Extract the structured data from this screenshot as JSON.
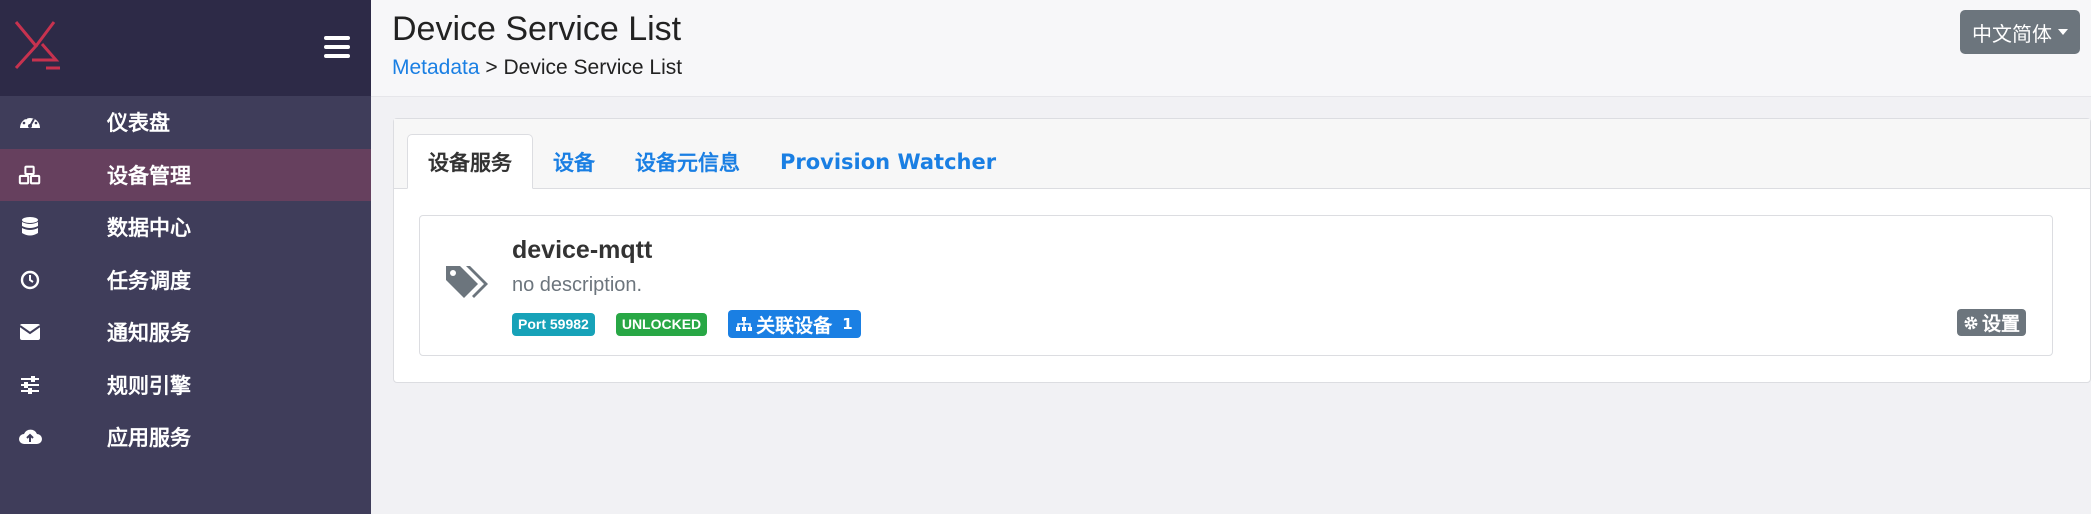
{
  "sidebar": {
    "items": [
      {
        "label": "仪表盘",
        "icon": "dashboard-icon",
        "active": false
      },
      {
        "label": "设备管理",
        "icon": "cubes-icon",
        "active": true
      },
      {
        "label": "数据中心",
        "icon": "database-icon",
        "active": false
      },
      {
        "label": "任务调度",
        "icon": "clock-icon",
        "active": false
      },
      {
        "label": "通知服务",
        "icon": "envelope-icon",
        "active": false
      },
      {
        "label": "规则引擎",
        "icon": "sliders-icon",
        "active": false
      },
      {
        "label": "应用服务",
        "icon": "cloud-upload-icon",
        "active": false
      }
    ]
  },
  "header": {
    "title": "Device Service List",
    "breadcrumb": {
      "parent": "Metadata",
      "separator": ">",
      "current": "Device Service List"
    },
    "language": "中文简体"
  },
  "tabs": [
    {
      "label": "设备服务",
      "active": true
    },
    {
      "label": "设备",
      "active": false
    },
    {
      "label": "设备元信息",
      "active": false
    },
    {
      "label": "Provision Watcher",
      "active": false
    }
  ],
  "service": {
    "name": "device-mqtt",
    "description": "no description.",
    "port_badge": "Port 59982",
    "lock_badge": "UNLOCKED",
    "assoc_label": "关联设备",
    "assoc_count": "1",
    "settings_label": "设置"
  },
  "colors": {
    "sidebar_bg": "#3f3d5a",
    "sidebar_header_bg": "#2d2a47",
    "active_item_bg": "#66405e",
    "link": "#1a7fe3",
    "badge_port": "#17a2b8",
    "badge_unlocked": "#28a745",
    "button_gray": "#6c757d",
    "logo": "#c7324f"
  }
}
